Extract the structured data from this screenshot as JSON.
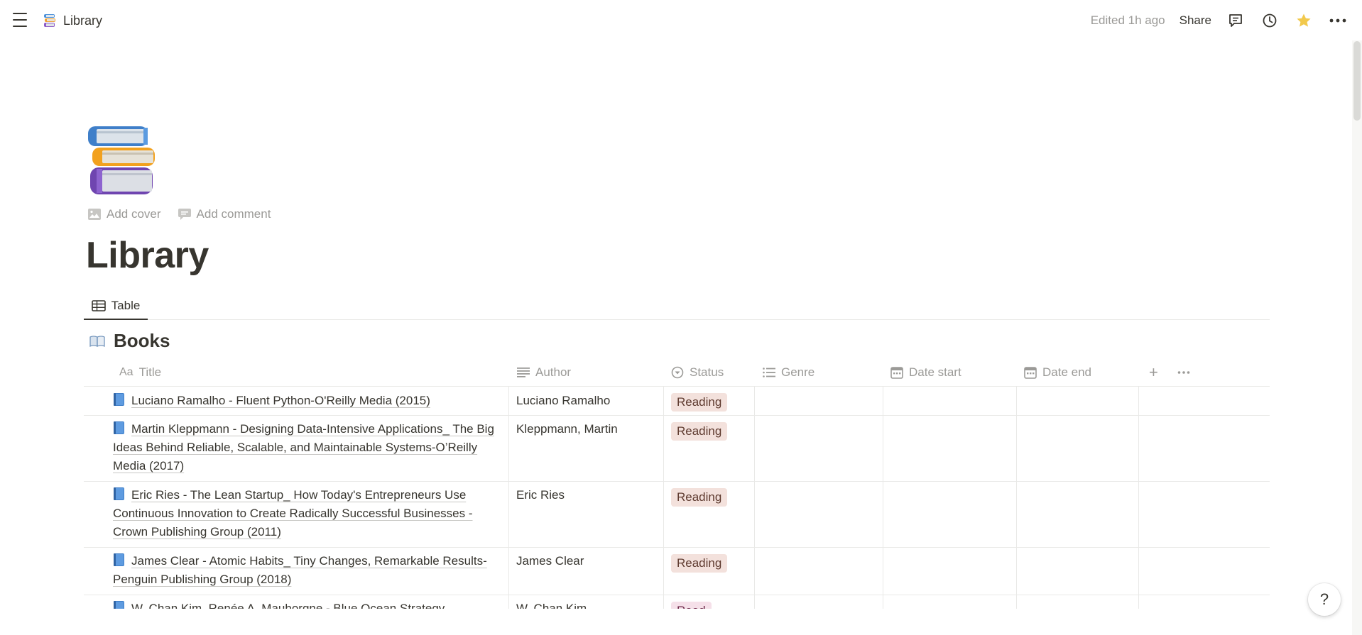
{
  "breadcrumb": {
    "page": "Library",
    "icon": "books-icon"
  },
  "topbar": {
    "edited": "Edited 1h ago",
    "share": "Share"
  },
  "page": {
    "title": "Library",
    "add_cover": "Add cover",
    "add_comment": "Add comment"
  },
  "views": [
    {
      "label": "Table",
      "icon": "table-icon"
    }
  ],
  "database": {
    "title": "Books",
    "columns": [
      {
        "label": "Title",
        "icon": "text-aa-icon"
      },
      {
        "label": "Author",
        "icon": "lines-icon"
      },
      {
        "label": "Status",
        "icon": "status-icon"
      },
      {
        "label": "Genre",
        "icon": "list-icon"
      },
      {
        "label": "Date start",
        "icon": "calendar-icon"
      },
      {
        "label": "Date end",
        "icon": "calendar-icon"
      }
    ],
    "rows": [
      {
        "title": "Luciano Ramalho - Fluent Python-O'Reilly Media (2015)",
        "author": "Luciano Ramalho",
        "status": "Reading"
      },
      {
        "title": "Martin Kleppmann - Designing Data-Intensive Applications_ The Big Ideas Behind Reliable, Scalable, and Maintainable Systems-O’Reilly Media (2017)",
        "author": "Kleppmann, Martin",
        "status": "Reading"
      },
      {
        "title": "Eric Ries - The Lean Startup_ How Today's Entrepreneurs Use Continuous Innovation to Create Radically Successful Businesses  -Crown Publishing Group (2011)",
        "author": "Eric Ries",
        "status": "Reading"
      },
      {
        "title": "James Clear - Atomic Habits_ Tiny Changes, Remarkable Results-Penguin Publishing Group (2018)",
        "author": "James Clear",
        "status": "Reading"
      },
      {
        "title": "W. Chan Kim, Renée A. Mauborgne - Blue Ocean Strategy",
        "author": "W. Chan Kim",
        "status": "Read"
      }
    ]
  },
  "help": "?",
  "colors": {
    "accent_star": "#f2c94c",
    "reading_tag": "#f3e1dc",
    "read_tag": "#f5e0e9"
  }
}
